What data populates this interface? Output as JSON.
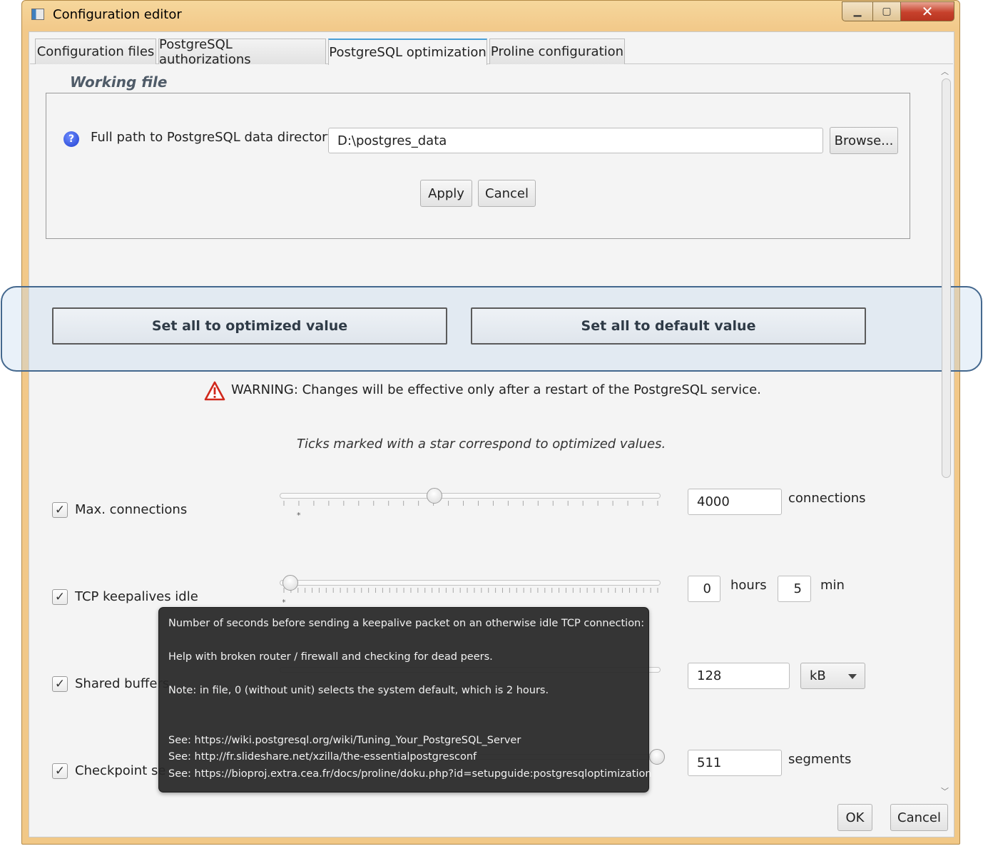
{
  "window": {
    "title": "Configuration editor",
    "minimize_symbol": "▁",
    "maximize_symbol": "▢",
    "close_symbol": "✕"
  },
  "tabs": [
    {
      "label": "Configuration files",
      "active": false
    },
    {
      "label": "PostgreSQL authorizations",
      "active": false
    },
    {
      "label": "PostgreSQL optimization",
      "active": true
    },
    {
      "label": "Proline configuration",
      "active": false
    }
  ],
  "working_file": {
    "title": "Working file",
    "path_label": "Full path to PostgreSQL data directory :",
    "path_value": "D:\\postgres_data",
    "browse_label": "Browse...",
    "apply_label": "Apply",
    "cancel_label": "Cancel",
    "help_icon": "question-icon"
  },
  "bulk_actions": {
    "optimized_label": "Set all to optimized value",
    "default_label": "Set all to default value",
    "highlight_color": "#44688e"
  },
  "warning": {
    "icon": "warning-icon",
    "text": "WARNING: Changes will be effective only after a restart of the PostgreSQL service.",
    "color": "#d0281c"
  },
  "hint": "Ticks marked with a star correspond to optimized values.",
  "settings": {
    "max_connections": {
      "label": "Max. connections",
      "checked": true,
      "slider_fraction": 0.4,
      "value": "4000",
      "unit": "connections"
    },
    "tcp_keepalives_idle": {
      "label": "TCP keepalives idle",
      "checked": true,
      "slider_fraction": 0.0,
      "hours": "0",
      "hours_unit": "hours",
      "minutes": "5",
      "minutes_unit": "min"
    },
    "shared_buffers": {
      "label": "Shared buffers",
      "checked": true,
      "value": "128",
      "unit_selected": "kB"
    },
    "checkpoint_segments": {
      "label": "Checkpoint se",
      "checked": true,
      "value": "511",
      "unit": "segments"
    }
  },
  "tooltip": {
    "line1": "Number of seconds before sending a keepalive packet on an otherwise idle TCP connection:",
    "line2": "Help with broken router / firewall and checking for dead peers.",
    "line3": "Note: in file, 0 (without unit) selects the system default, which is 2 hours.",
    "link1": "See: https://wiki.postgresql.org/wiki/Tuning_Your_PostgreSQL_Server",
    "link2": "See: http://fr.slideshare.net/xzilla/the-essentialpostgresconf",
    "link3": "See: https://bioproj.extra.cea.fr/docs/proline/doku.php?id=setupguide:postgresqloptimization"
  },
  "footer": {
    "ok_label": "OK",
    "cancel_label": "Cancel"
  }
}
